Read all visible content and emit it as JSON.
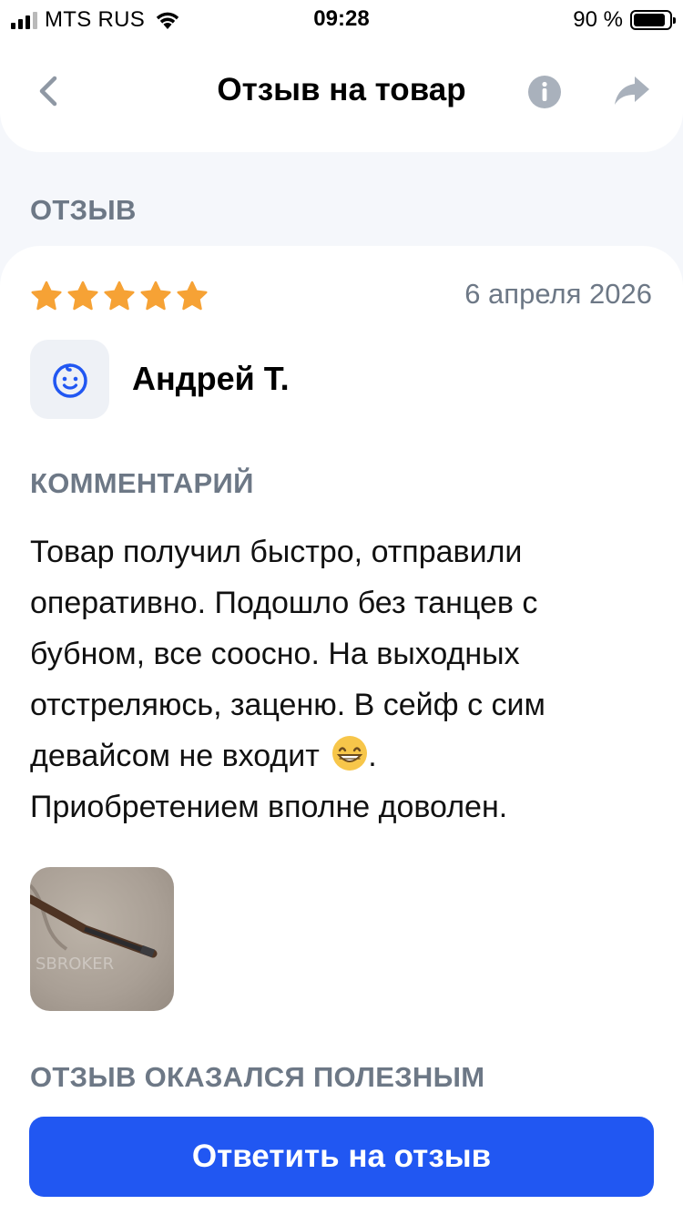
{
  "status_bar": {
    "carrier": "MTS RUS",
    "time": "09:28",
    "battery_percent": "90 %",
    "battery_level": 0.9,
    "signal_bars_active": 3,
    "signal_bars_total": 4
  },
  "nav": {
    "title": "Отзыв на товар",
    "back_icon": "chevron-left-icon",
    "info_icon": "info-icon",
    "share_icon": "share-icon"
  },
  "review": {
    "section_title": "ОТЗЫВ",
    "rating": 5,
    "rating_max": 5,
    "date": "6 апреля 2026",
    "author": "Андрей Т.",
    "avatar_icon": "baby-face-icon",
    "comment_title": "КОММЕНТАРИЙ",
    "comment_text": "Товар получил быстро, отправили оперативно. Подошло без танцев с бубном, все соосно. На выходных отстреляюсь, заценю. В сейф с сим девайсом не входит",
    "comment_tail": "Приобретением вполне доволен.",
    "emoji": "grinning-face-emoji",
    "photo_watermark": "SBROKER",
    "helpful_title": "ОТЗЫВ ОКАЗАЛСЯ ПОЛЕЗНЫМ"
  },
  "actions": {
    "reply_label": "Ответить на отзыв"
  },
  "colors": {
    "accent": "#2157f2",
    "star": "#f6a235",
    "secondary_text": "#6d7886",
    "icon_gray": "#a9b1bc",
    "avatar_icon": "#2157f2"
  }
}
